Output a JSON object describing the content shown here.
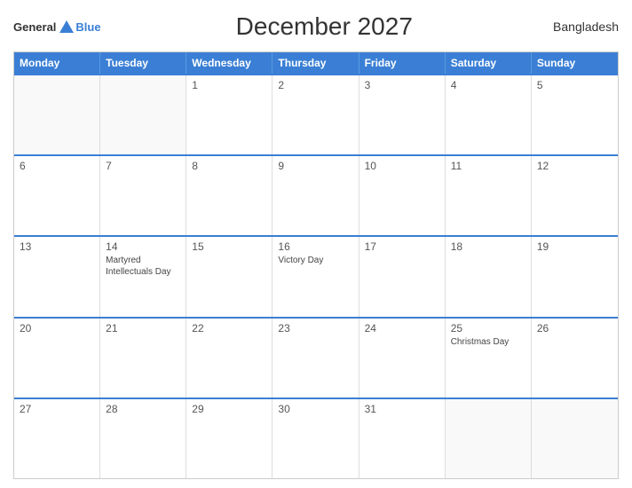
{
  "header": {
    "logo_general": "General",
    "logo_blue": "Blue",
    "title": "December 2027",
    "country": "Bangladesh"
  },
  "days_of_week": [
    "Monday",
    "Tuesday",
    "Wednesday",
    "Thursday",
    "Friday",
    "Saturday",
    "Sunday"
  ],
  "weeks": [
    [
      {
        "day": "",
        "event": ""
      },
      {
        "day": "",
        "event": ""
      },
      {
        "day": "1",
        "event": ""
      },
      {
        "day": "2",
        "event": ""
      },
      {
        "day": "3",
        "event": ""
      },
      {
        "day": "4",
        "event": ""
      },
      {
        "day": "5",
        "event": ""
      }
    ],
    [
      {
        "day": "6",
        "event": ""
      },
      {
        "day": "7",
        "event": ""
      },
      {
        "day": "8",
        "event": ""
      },
      {
        "day": "9",
        "event": ""
      },
      {
        "day": "10",
        "event": ""
      },
      {
        "day": "11",
        "event": ""
      },
      {
        "day": "12",
        "event": ""
      }
    ],
    [
      {
        "day": "13",
        "event": ""
      },
      {
        "day": "14",
        "event": "Martyred Intellectuals Day"
      },
      {
        "day": "15",
        "event": ""
      },
      {
        "day": "16",
        "event": "Victory Day"
      },
      {
        "day": "17",
        "event": ""
      },
      {
        "day": "18",
        "event": ""
      },
      {
        "day": "19",
        "event": ""
      }
    ],
    [
      {
        "day": "20",
        "event": ""
      },
      {
        "day": "21",
        "event": ""
      },
      {
        "day": "22",
        "event": ""
      },
      {
        "day": "23",
        "event": ""
      },
      {
        "day": "24",
        "event": ""
      },
      {
        "day": "25",
        "event": "Christmas Day"
      },
      {
        "day": "26",
        "event": ""
      }
    ],
    [
      {
        "day": "27",
        "event": ""
      },
      {
        "day": "28",
        "event": ""
      },
      {
        "day": "29",
        "event": ""
      },
      {
        "day": "30",
        "event": ""
      },
      {
        "day": "31",
        "event": ""
      },
      {
        "day": "",
        "event": ""
      },
      {
        "day": "",
        "event": ""
      }
    ]
  ]
}
